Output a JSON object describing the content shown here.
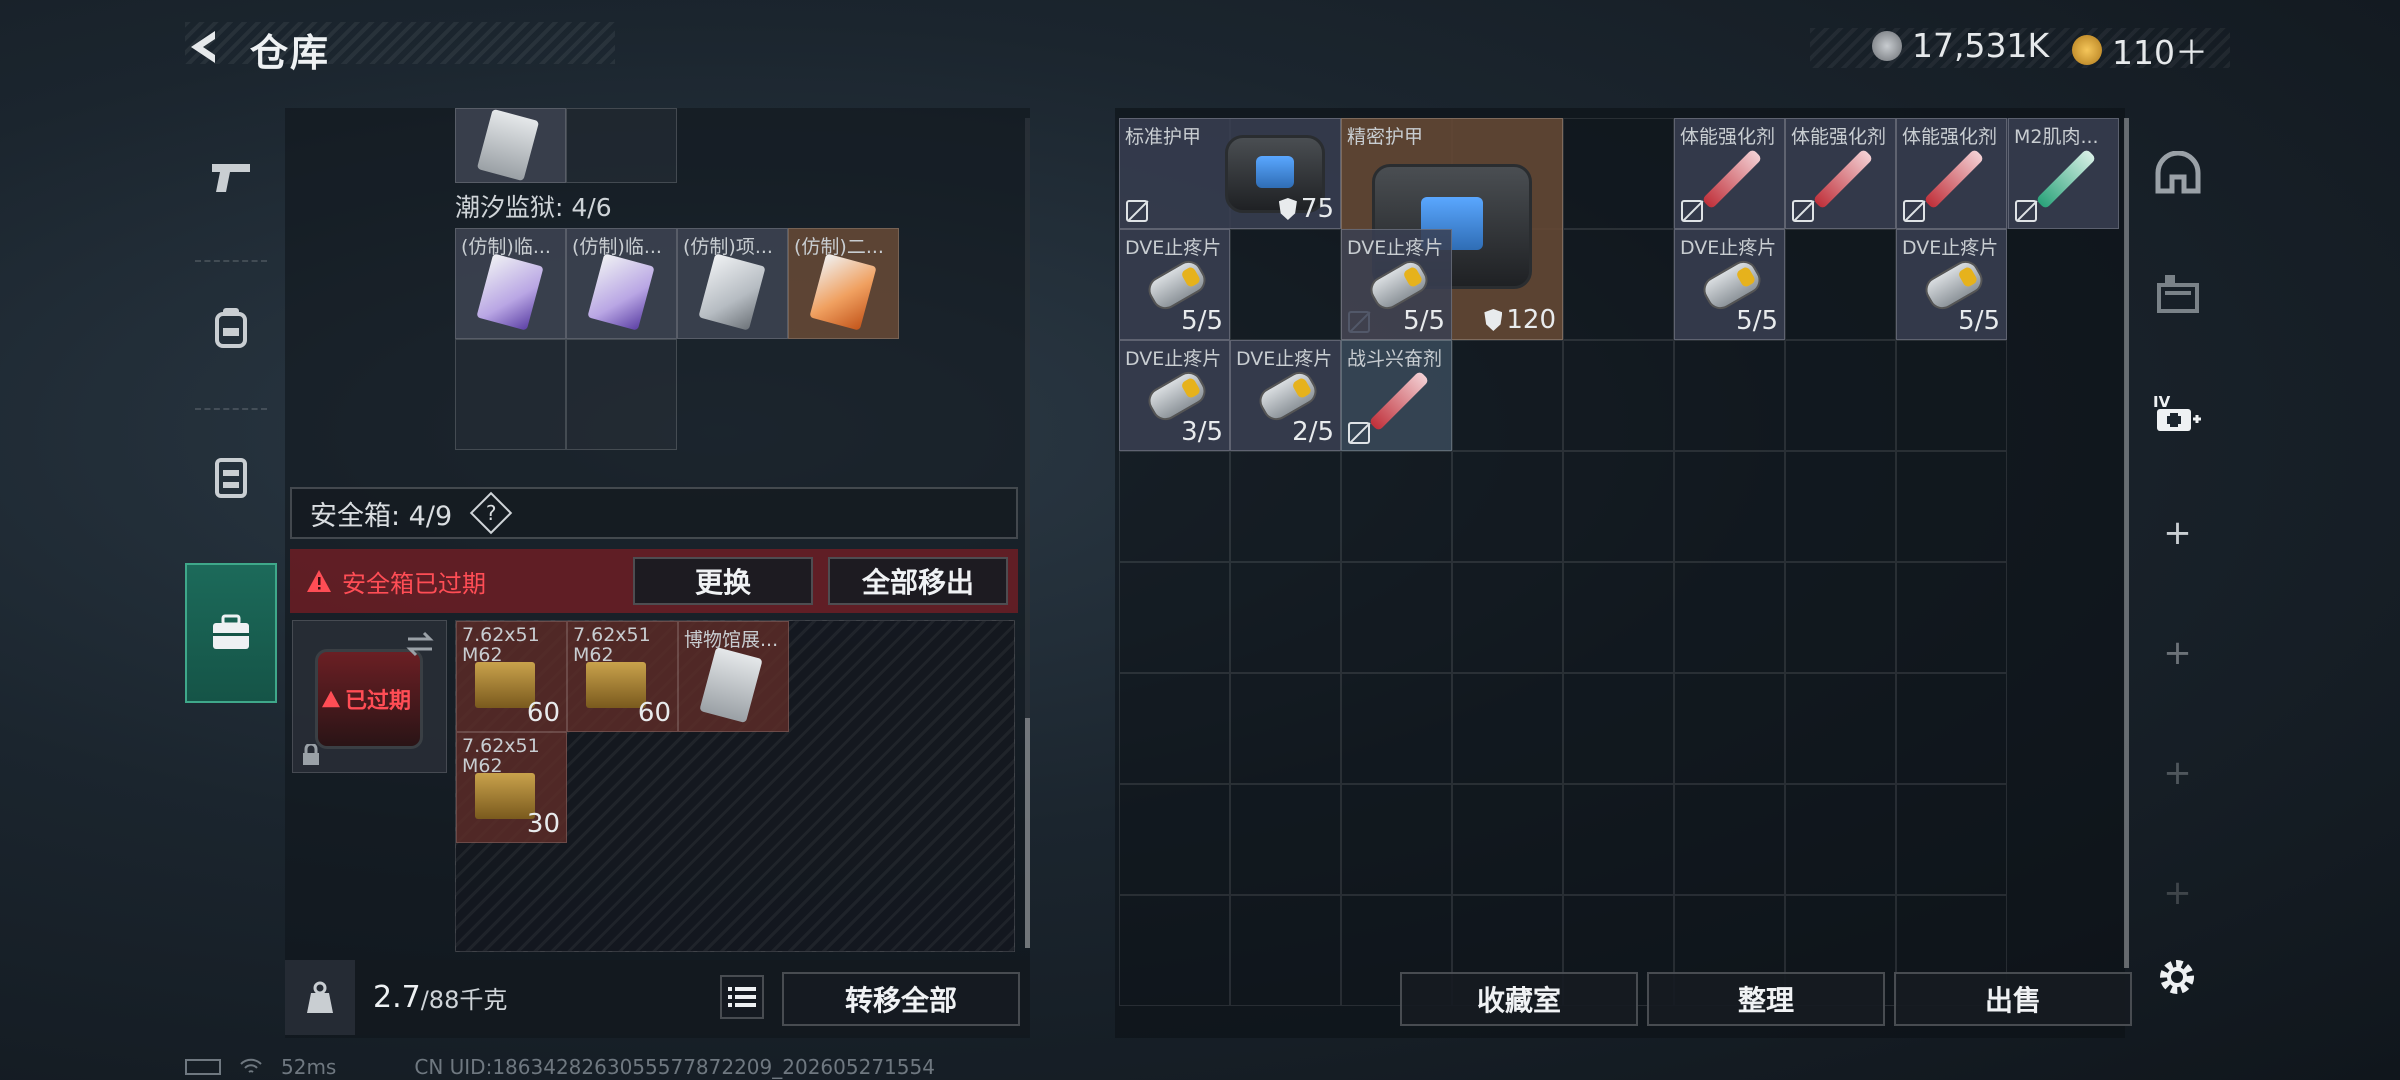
{
  "header": {
    "title": "仓库",
    "currency1": "17,531K",
    "currency2": "110＋"
  },
  "left": {
    "prison_label": "潮汐监狱: 4/6",
    "prison_items": [
      {
        "name": "(仿制)临...",
        "color": "purple"
      },
      {
        "name": "(仿制)临...",
        "color": "purple"
      },
      {
        "name": "(仿制)项...",
        "color": "gray"
      },
      {
        "name": "(仿制)二...",
        "color": "orange"
      }
    ],
    "safe_title": "安全箱: 4/9",
    "safe_help": "?",
    "expired_text": "安全箱已过期",
    "btn_replace": "更换",
    "btn_remove_all": "全部移出",
    "box_expired": "已过期",
    "safe_items": [
      {
        "name": "7.62x51 M62",
        "count": "60"
      },
      {
        "name": "7.62x51 M62",
        "count": "60"
      },
      {
        "name": "博物馆展...",
        "count": ""
      },
      {
        "name": "7.62x51 M62",
        "count": "30"
      }
    ],
    "weight": "2.7",
    "weight_max": "/88千克",
    "btn_transfer_all": "转移全部"
  },
  "right": {
    "items": [
      {
        "name": "标准护甲",
        "value": "75"
      },
      {
        "name": "精密护甲",
        "value": "120"
      },
      {
        "name": "体能强化剂"
      },
      {
        "name": "体能强化剂"
      },
      {
        "name": "体能强化剂"
      },
      {
        "name": "M2肌肉..."
      },
      {
        "name": "DVE止疼片",
        "count": "5/5"
      },
      {
        "name": "DVE止疼片",
        "count": "5/5"
      },
      {
        "name": "DVE止疼片",
        "count": "5/5"
      },
      {
        "name": "DVE止疼片",
        "count": "5/5"
      },
      {
        "name": "DVE止疼片",
        "count": "3/5"
      },
      {
        "name": "DVE止疼片",
        "count": "2/5"
      },
      {
        "name": "战斗兴奋剂"
      }
    ],
    "btn_collection": "收藏室",
    "btn_sort": "整理",
    "btn_sell": "出售"
  },
  "status": {
    "ping": "52ms",
    "uid": "CN UID:1863428263055577872209_202605271554"
  },
  "colors": {
    "accent": "#1c6a5a",
    "expired": "#ff4d55"
  }
}
